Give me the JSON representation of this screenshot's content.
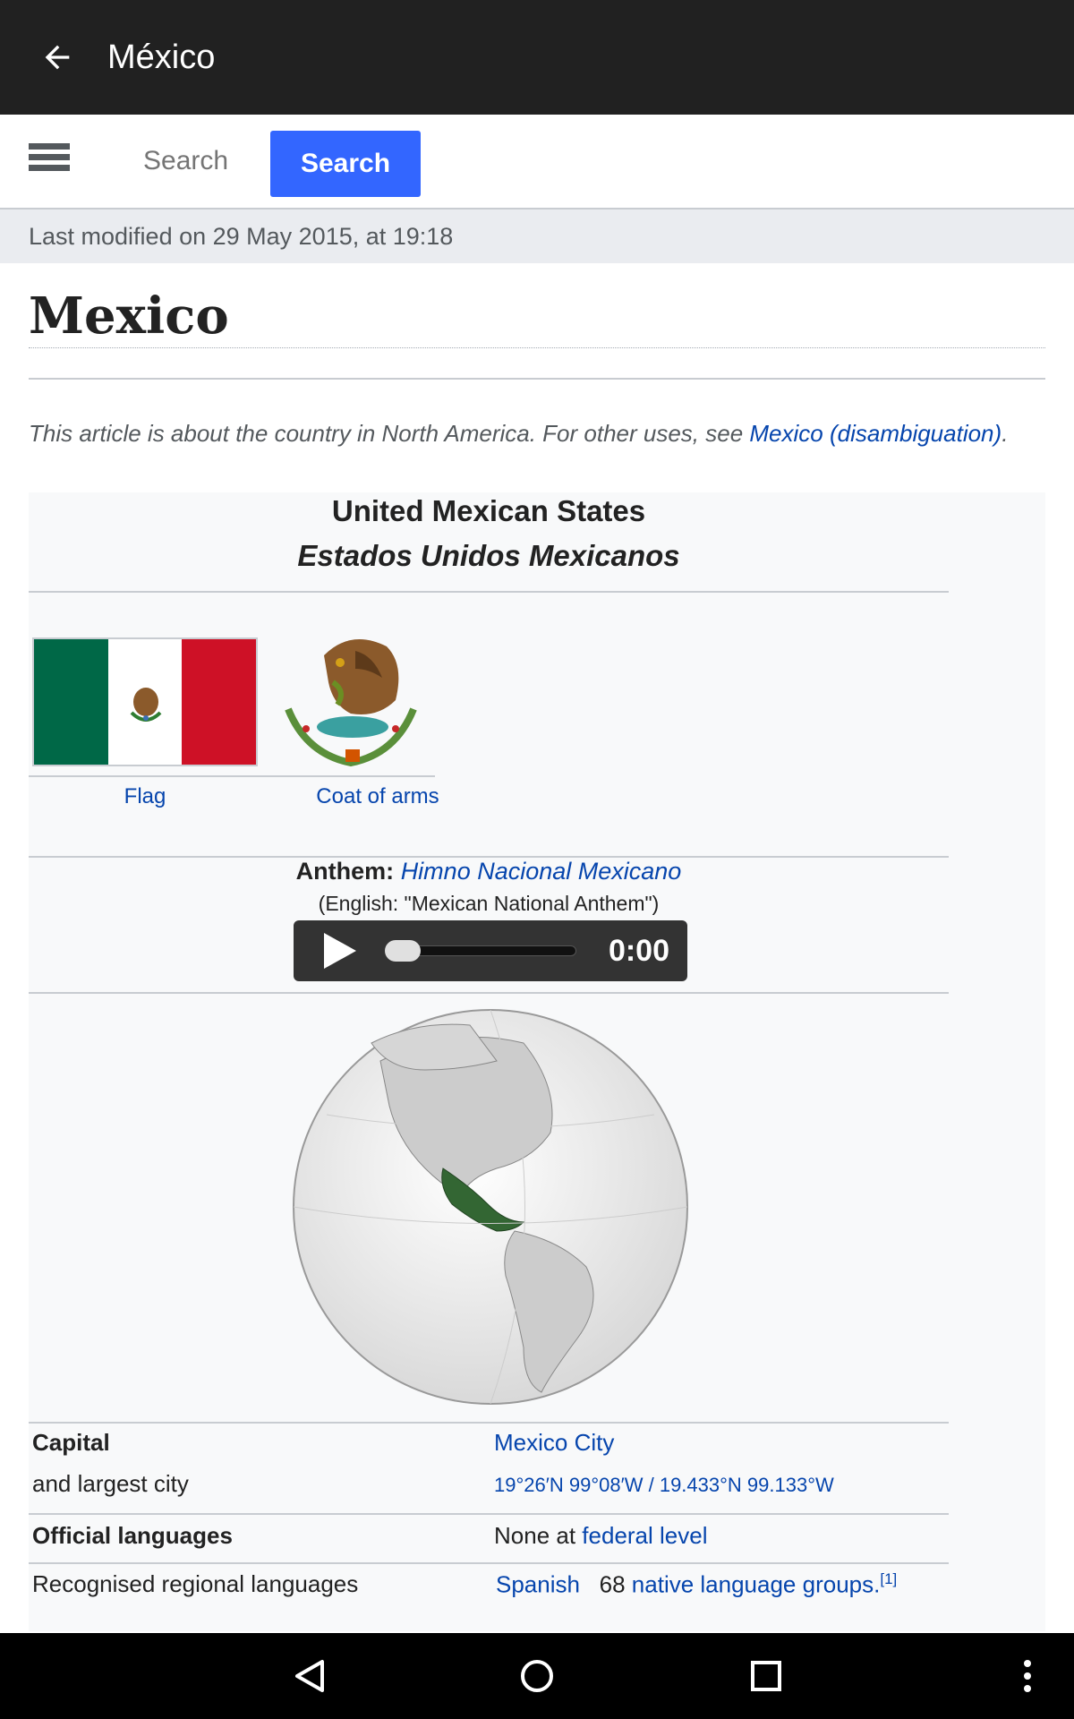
{
  "app": {
    "title": "México"
  },
  "search": {
    "placeholder": "Search",
    "button_label": "Search"
  },
  "last_modified": "Last modified on 29 May 2015, at 19:18",
  "article": {
    "title": "Mexico",
    "hatnote_prefix": "This article is about the country in North America. For other uses, see ",
    "hatnote_link": "Mexico (disambiguation)",
    "hatnote_suffix": "."
  },
  "infobox": {
    "name": "United Mexican States",
    "native_name": "Estados Unidos Mexicanos",
    "flag_label": "Flag",
    "coat_label": "Coat of arms",
    "anthem_label": "Anthem:",
    "anthem_name": "Himno Nacional Mexicano",
    "anthem_english": "(English: \"Mexican National Anthem\")",
    "player_time": "0:00",
    "player_progress": 0.0,
    "rows": [
      {
        "label": "Capital",
        "value": "Mexico City"
      },
      {
        "label": "and largest city",
        "value": "19°26′N 99°08′W / 19.433°N 99.133°W"
      },
      {
        "label": "Official languages",
        "value_prefix": "None at ",
        "value_link": "federal level"
      },
      {
        "label": "Recognised regional languages",
        "value_link1": "Spanish",
        "value_text": "68 ",
        "value_link2": "native language groups.",
        "sup": "[1]"
      }
    ]
  },
  "colors": {
    "topbar": "#212121",
    "accent": "#3366ff",
    "link": "#0645ad",
    "flag_green": "#006847",
    "flag_red": "#ce1126",
    "mexico_highlight": "#336633"
  },
  "icons": {
    "back": "arrow-left-icon",
    "menu": "hamburger-icon",
    "play": "play-icon",
    "nav_back": "triangle-back-icon",
    "nav_home": "circle-home-icon",
    "nav_recents": "square-recents-icon",
    "overflow": "vertical-dots-icon"
  }
}
